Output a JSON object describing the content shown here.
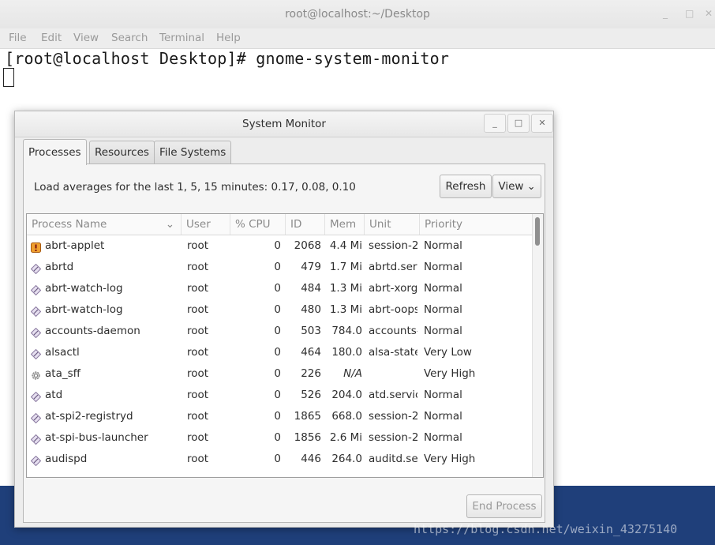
{
  "terminal": {
    "title": "root@localhost:~/Desktop",
    "menu": [
      "File",
      "Edit",
      "View",
      "Search",
      "Terminal",
      "Help"
    ],
    "prompt_line": "[root@localhost Desktop]# gnome-system-monitor",
    "controls": {
      "minimize": "_",
      "maximize": "□",
      "close": "✕"
    }
  },
  "sysmon": {
    "title": "System Monitor",
    "controls": {
      "minimize": "_",
      "maximize": "□",
      "close": "✕"
    },
    "tabs": [
      "Processes",
      "Resources",
      "File Systems"
    ],
    "active_tab": "Processes",
    "load_text": "Load averages for the last 1, 5, 15 minutes: 0.17, 0.08, 0.10",
    "refresh_label": "Refresh",
    "view_label": "View",
    "view_chevron": "⌄",
    "end_process_label": "End Process",
    "columns": [
      "Process Name",
      "User",
      "% CPU",
      "ID",
      "Mem",
      "Unit",
      "Priority"
    ],
    "sort_indicator": "⌄",
    "processes": [
      {
        "icon": "alert-process-icon",
        "name": "abrt-applet",
        "user": "root",
        "cpu": "0",
        "id": "2068",
        "mem": "4.4 Mi",
        "unit": "session-2",
        "priority": "Normal"
      },
      {
        "icon": "process-icon",
        "name": "abrtd",
        "user": "root",
        "cpu": "0",
        "id": "479",
        "mem": "1.7 Mi",
        "unit": "abrtd.serv",
        "priority": "Normal"
      },
      {
        "icon": "process-icon",
        "name": "abrt-watch-log",
        "user": "root",
        "cpu": "0",
        "id": "484",
        "mem": "1.3 Mi",
        "unit": "abrt-xorg",
        "priority": "Normal"
      },
      {
        "icon": "process-icon",
        "name": "abrt-watch-log",
        "user": "root",
        "cpu": "0",
        "id": "480",
        "mem": "1.3 Mi",
        "unit": "abrt-oops",
        "priority": "Normal"
      },
      {
        "icon": "process-icon",
        "name": "accounts-daemon",
        "user": "root",
        "cpu": "0",
        "id": "503",
        "mem": "784.0",
        "unit": "accounts-",
        "priority": "Normal"
      },
      {
        "icon": "process-icon",
        "name": "alsactl",
        "user": "root",
        "cpu": "0",
        "id": "464",
        "mem": "180.0",
        "unit": "alsa-state",
        "priority": "Very Low"
      },
      {
        "icon": "gear-icon",
        "name": "ata_sff",
        "user": "root",
        "cpu": "0",
        "id": "226",
        "mem": "N/A",
        "unit": "",
        "priority": "Very High"
      },
      {
        "icon": "process-icon",
        "name": "atd",
        "user": "root",
        "cpu": "0",
        "id": "526",
        "mem": "204.0",
        "unit": "atd.servic",
        "priority": "Normal"
      },
      {
        "icon": "process-icon",
        "name": "at-spi2-registryd",
        "user": "root",
        "cpu": "0",
        "id": "1865",
        "mem": "668.0",
        "unit": "session-2",
        "priority": "Normal"
      },
      {
        "icon": "process-icon",
        "name": "at-spi-bus-launcher",
        "user": "root",
        "cpu": "0",
        "id": "1856",
        "mem": "2.6 Mi",
        "unit": "session-2",
        "priority": "Normal"
      },
      {
        "icon": "process-icon",
        "name": "audispd",
        "user": "root",
        "cpu": "0",
        "id": "446",
        "mem": "264.0",
        "unit": "auditd.ser",
        "priority": "Very High"
      }
    ]
  },
  "watermark": "https://blog.csdn.net/weixin_43275140",
  "colors": {
    "desktop": "#1f3f7a",
    "window_bg": "#ededed",
    "text": "#2e2e2e",
    "muted": "#8a8a8a"
  }
}
